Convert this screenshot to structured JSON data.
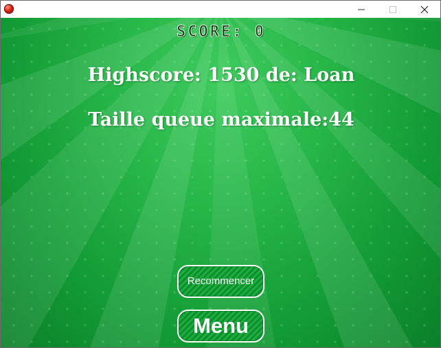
{
  "game": {
    "score_text": "SCORE: 0",
    "highscore_text": "Highscore: 1530 de: Loan",
    "max_tail_text": "Taille queue maximale:44",
    "restart_label": "Recommencer",
    "menu_label": "Menu"
  },
  "icons": {
    "app": "red-ball-icon",
    "minimize": "minimize-icon",
    "maximize": "maximize-icon",
    "close": "close-icon"
  },
  "colors": {
    "background_green": "#26b548",
    "button_stripe_dark": "#0f8f2c",
    "button_stripe_light": "#1fae43",
    "text_white": "#ffffff"
  }
}
